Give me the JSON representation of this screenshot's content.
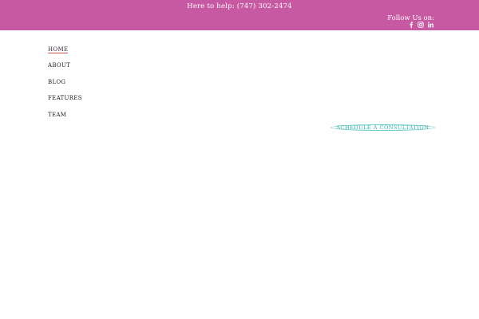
{
  "topbar": {
    "help_text": "Here to help: (747) 302-2474",
    "follow_text": "Follow Us on:",
    "background": "#c659a2",
    "social": [
      "facebook-icon",
      "instagram-icon",
      "linkedin-icon"
    ]
  },
  "nav": {
    "items": [
      {
        "label": "HOME",
        "active": true
      },
      {
        "label": "ABOUT",
        "active": false
      },
      {
        "label": "BLOG",
        "active": false
      },
      {
        "label": "FEATURES",
        "active": false
      },
      {
        "label": "TEAM",
        "active": false
      }
    ]
  },
  "cta": {
    "label": "SCHEDULE A CONSULTATION",
    "color": "#2db3b0"
  }
}
